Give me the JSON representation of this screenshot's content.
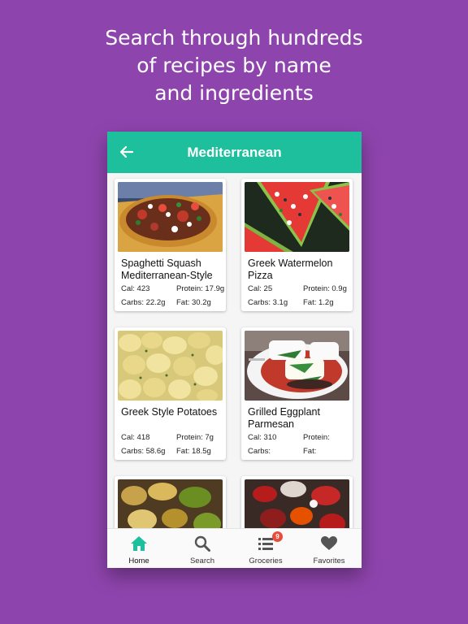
{
  "headline": {
    "line1": "Search through hundreds",
    "line2": "of recipes by name",
    "line3": "and ingredients"
  },
  "colors": {
    "background": "#8e44ad",
    "accent": "#1dbf9c",
    "badge": "#e74c3c"
  },
  "appbar": {
    "title": "Mediterranean",
    "back_icon": "arrow-left-icon"
  },
  "recipes": [
    {
      "name": "Spaghetti Squash Mediterranean-Style",
      "cal_label": "Cal: 423",
      "protein_label": "Protein: 17.9g",
      "carbs_label": "Carbs: 22.2g",
      "fat_label": "Fat: 30.2g"
    },
    {
      "name": "Greek Watermelon Pizza",
      "cal_label": "Cal: 25",
      "protein_label": "Protein: 0.9g",
      "carbs_label": "Carbs: 3.1g",
      "fat_label": "Fat: 1.2g"
    },
    {
      "name": "Greek Style Potatoes",
      "cal_label": "Cal: 418",
      "protein_label": "Protein: 7g",
      "carbs_label": "Carbs: 58.6g",
      "fat_label": "Fat: 18.5g"
    },
    {
      "name": "Grilled Eggplant Parmesan",
      "cal_label": "Cal: 310",
      "protein_label": "Protein:",
      "carbs_label": "Carbs:",
      "fat_label": "Fat:"
    }
  ],
  "bottom_nav": {
    "home": "Home",
    "search": "Search",
    "groceries": "Groceries",
    "groceries_badge": "9",
    "favorites": "Favorites"
  }
}
